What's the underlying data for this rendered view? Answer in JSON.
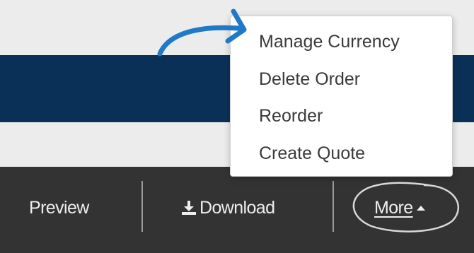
{
  "colors": {
    "navy_band": "#0b3058",
    "toolbar_bg": "#333333",
    "annotation_blue": "#1f78c8",
    "annotation_circle": "#d8d8d8"
  },
  "dropdown_menu": {
    "items": [
      {
        "label": "Manage Currency"
      },
      {
        "label": "Delete Order"
      },
      {
        "label": "Reorder"
      },
      {
        "label": "Create Quote"
      }
    ]
  },
  "toolbar": {
    "preview_label": "Preview",
    "download_label": "Download",
    "download_icon": "download-icon",
    "more_label": "More",
    "more_icon": "caret-up-icon"
  },
  "annotations": {
    "arrow": "curved-arrow-pointing-to-menu",
    "circle": "hand-drawn-circle-around-more"
  }
}
